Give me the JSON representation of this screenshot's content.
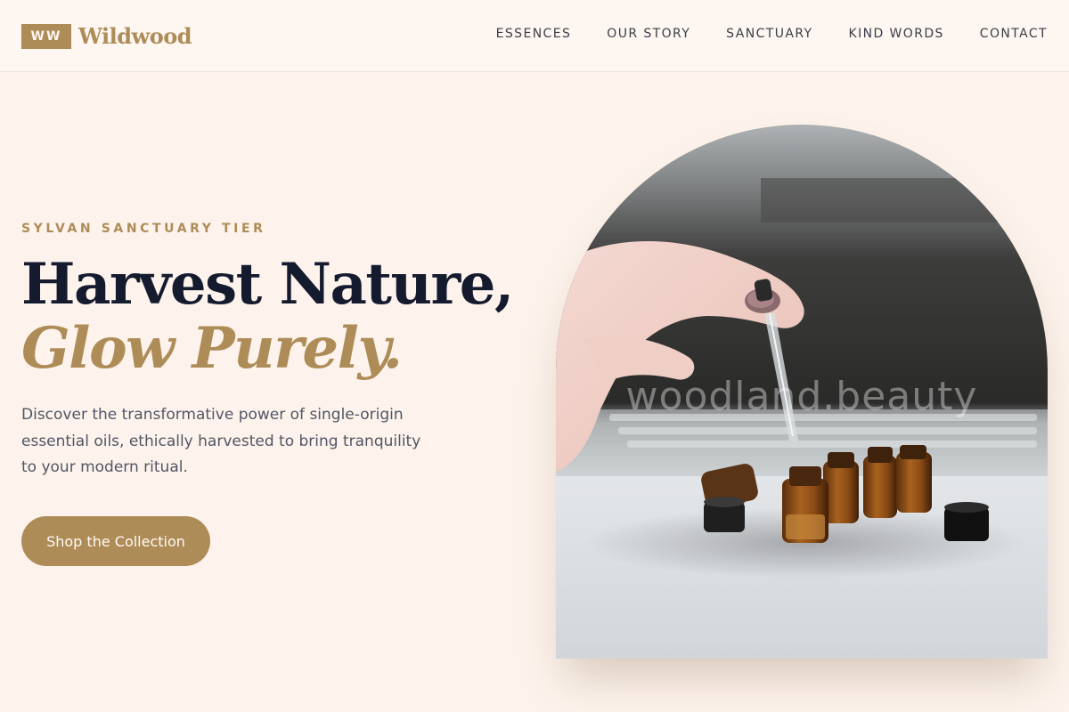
{
  "brand": {
    "mark": "WW",
    "name": "Wildwood",
    "accent": "#ae8c58"
  },
  "nav": {
    "items": [
      {
        "label": "ESSENCES"
      },
      {
        "label": "OUR STORY"
      },
      {
        "label": "SANCTUARY"
      },
      {
        "label": "KIND WORDS"
      },
      {
        "label": "CONTACT"
      }
    ]
  },
  "hero": {
    "eyebrow": "SYLVAN SANCTUARY TIER",
    "headline_line1": "Harvest Nature,",
    "headline_line2": "Glow Purely.",
    "lead": "Discover the transformative power of single-origin essential oils, ethically harvested to bring tranquility to your modern ritual.",
    "cta_label": "Shop the Collection",
    "image_watermark": "woodland.beauty",
    "image_alt": "Hand holding a glass dropper above small amber essential oil bottles"
  },
  "colors": {
    "background": "#fdf3ec",
    "heading": "#151b2e",
    "accent": "#ae8c58",
    "body_text": "#515565"
  }
}
